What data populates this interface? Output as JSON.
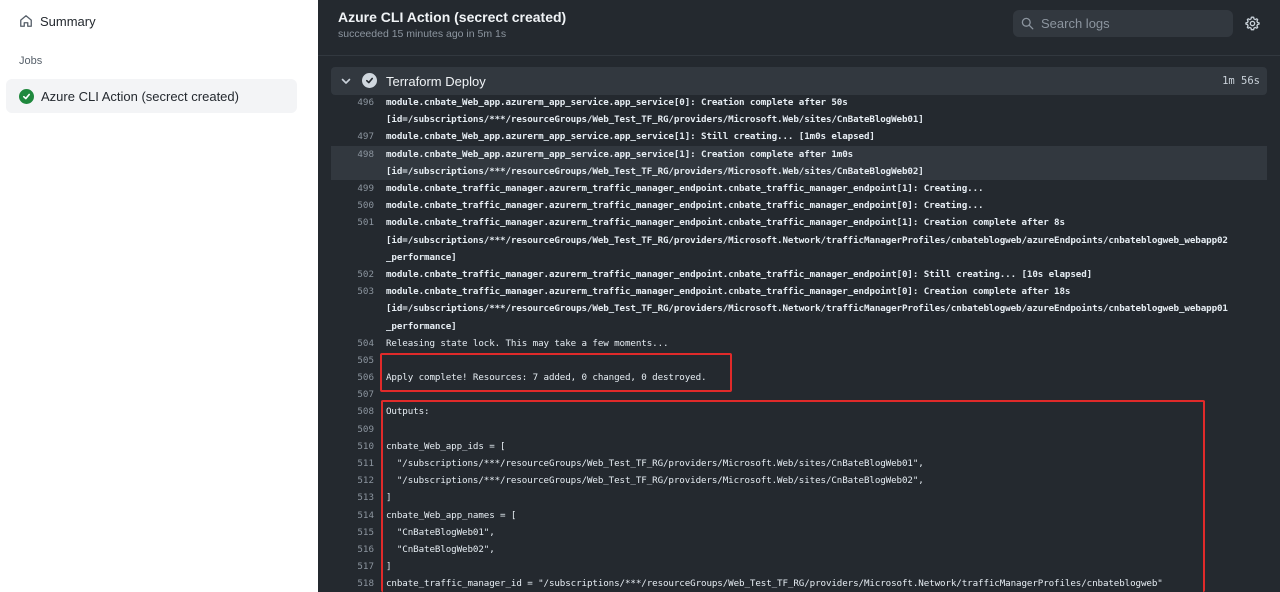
{
  "sidebar": {
    "summary_label": "Summary",
    "jobs_heading": "Jobs",
    "job": {
      "label": "Azure CLI Action (secrect created)",
      "status": "success"
    }
  },
  "run": {
    "title": "Azure CLI Action (secrect created)",
    "subtitle": "succeeded 15 minutes ago in 5m 1s"
  },
  "search": {
    "placeholder": "Search logs"
  },
  "step": {
    "name": "Terraform Deploy",
    "duration": "1m 56s",
    "status": "success",
    "expanded": true
  },
  "log_lines": [
    {
      "n": "496",
      "text": "module.cnbate_Web_app.azurerm_app_service.app_service[0]: Creation complete after 50s",
      "bold": true
    },
    {
      "n": "",
      "text": "[id=/subscriptions/***/resourceGroups/Web_Test_TF_RG/providers/Microsoft.Web/sites/CnBateBlogWeb01]",
      "bold": true
    },
    {
      "n": "497",
      "text": "module.cnbate_Web_app.azurerm_app_service.app_service[1]: Still creating... [1m0s elapsed]",
      "bold": true
    },
    {
      "n": "498",
      "text": "module.cnbate_Web_app.azurerm_app_service.app_service[1]: Creation complete after 1m0s",
      "bold": true,
      "highlight": true
    },
    {
      "n": "",
      "text": "[id=/subscriptions/***/resourceGroups/Web_Test_TF_RG/providers/Microsoft.Web/sites/CnBateBlogWeb02]",
      "bold": true,
      "highlight": true
    },
    {
      "n": "499",
      "text": "module.cnbate_traffic_manager.azurerm_traffic_manager_endpoint.cnbate_traffic_manager_endpoint[1]: Creating...",
      "bold": true
    },
    {
      "n": "500",
      "text": "module.cnbate_traffic_manager.azurerm_traffic_manager_endpoint.cnbate_traffic_manager_endpoint[0]: Creating...",
      "bold": true
    },
    {
      "n": "501",
      "text": "module.cnbate_traffic_manager.azurerm_traffic_manager_endpoint.cnbate_traffic_manager_endpoint[1]: Creation complete after 8s",
      "bold": true
    },
    {
      "n": "",
      "text": "[id=/subscriptions/***/resourceGroups/Web_Test_TF_RG/providers/Microsoft.Network/trafficManagerProfiles/cnbateblogweb/azureEndpoints/cnbateblogweb_webapp02",
      "bold": true
    },
    {
      "n": "",
      "text": "_performance]",
      "bold": true
    },
    {
      "n": "502",
      "text": "module.cnbate_traffic_manager.azurerm_traffic_manager_endpoint.cnbate_traffic_manager_endpoint[0]: Still creating... [10s elapsed]",
      "bold": true
    },
    {
      "n": "503",
      "text": "module.cnbate_traffic_manager.azurerm_traffic_manager_endpoint.cnbate_traffic_manager_endpoint[0]: Creation complete after 18s",
      "bold": true
    },
    {
      "n": "",
      "text": "[id=/subscriptions/***/resourceGroups/Web_Test_TF_RG/providers/Microsoft.Network/trafficManagerProfiles/cnbateblogweb/azureEndpoints/cnbateblogweb_webapp01",
      "bold": true
    },
    {
      "n": "",
      "text": "_performance]",
      "bold": true
    },
    {
      "n": "504",
      "text": "Releasing state lock. This may take a few moments...",
      "bold": false
    },
    {
      "n": "505",
      "text": "",
      "bold": false
    },
    {
      "n": "506",
      "text": "Apply complete! Resources: 7 added, 0 changed, 0 destroyed.",
      "bold": false
    },
    {
      "n": "507",
      "text": "",
      "bold": false
    },
    {
      "n": "508",
      "text": "Outputs:",
      "bold": false
    },
    {
      "n": "509",
      "text": "",
      "bold": false
    },
    {
      "n": "510",
      "text": "cnbate_Web_app_ids = [",
      "bold": false
    },
    {
      "n": "511",
      "text": "  \"/subscriptions/***/resourceGroups/Web_Test_TF_RG/providers/Microsoft.Web/sites/CnBateBlogWeb01\",",
      "bold": false
    },
    {
      "n": "512",
      "text": "  \"/subscriptions/***/resourceGroups/Web_Test_TF_RG/providers/Microsoft.Web/sites/CnBateBlogWeb02\",",
      "bold": false
    },
    {
      "n": "513",
      "text": "]",
      "bold": false
    },
    {
      "n": "514",
      "text": "cnbate_Web_app_names = [",
      "bold": false
    },
    {
      "n": "515",
      "text": "  \"CnBateBlogWeb01\",",
      "bold": false
    },
    {
      "n": "516",
      "text": "  \"CnBateBlogWeb02\",",
      "bold": false
    },
    {
      "n": "517",
      "text": "]",
      "bold": false
    },
    {
      "n": "518",
      "text": "cnbate_traffic_manager_id = \"/subscriptions/***/resourceGroups/Web_Test_TF_RG/providers/Microsoft.Network/trafficManagerProfiles/cnbateblogweb\"",
      "bold": false
    }
  ],
  "colors": {
    "annotation_box": "#e02a2a",
    "success_green": "#1f883d",
    "log_background": "#24292f"
  }
}
